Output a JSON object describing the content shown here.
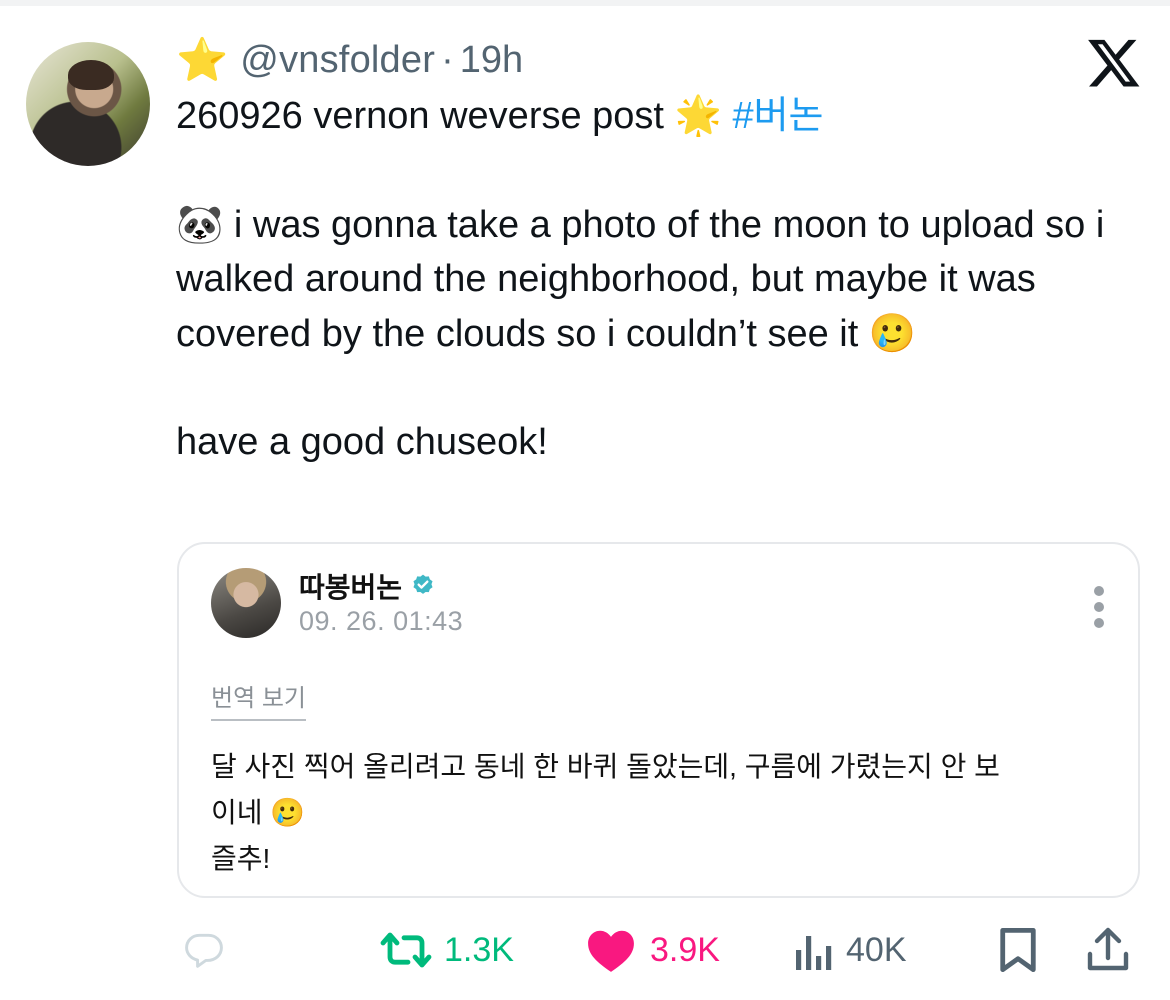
{
  "tweet": {
    "header_emoji": "⭐",
    "handle": "@vnsfolder",
    "separator": "·",
    "time": "19h",
    "title_line": "260926 vernon weverse post",
    "title_emoji": "🌟",
    "hashtag": "#버논",
    "paragraph_emoji": "🐼",
    "paragraph": "i was gonna take a photo of the moon to upload so i walked around the neighborhood, but maybe it was covered by the clouds so i couldn’t see it",
    "paragraph_end_emoji": "🥲",
    "closing": "have a good chuseok!"
  },
  "quote": {
    "name": "따봉버논",
    "timestamp": "09. 26. 01:43",
    "translate_link": "번역 보기",
    "line1": "달 사진 찍어 올리려고 동네 한 바퀴 돌았는데, 구름에 가렸는지 안 보",
    "line2": "이네",
    "line2_emoji": "🥲",
    "line3": "즐추!"
  },
  "actions": {
    "retweets": "1.3K",
    "likes": "3.9K",
    "views": "40K"
  },
  "colors": {
    "retweet": "#00ba7c",
    "like": "#f91880",
    "hashtag": "#1d9bf0",
    "muted": "#536471",
    "verified": "#3fb8c6"
  },
  "icons": [
    "x-logo-icon",
    "verified-icon",
    "more-icon",
    "reply-icon",
    "retweet-icon",
    "heart-icon",
    "views-icon",
    "bookmark-icon",
    "share-icon"
  ]
}
